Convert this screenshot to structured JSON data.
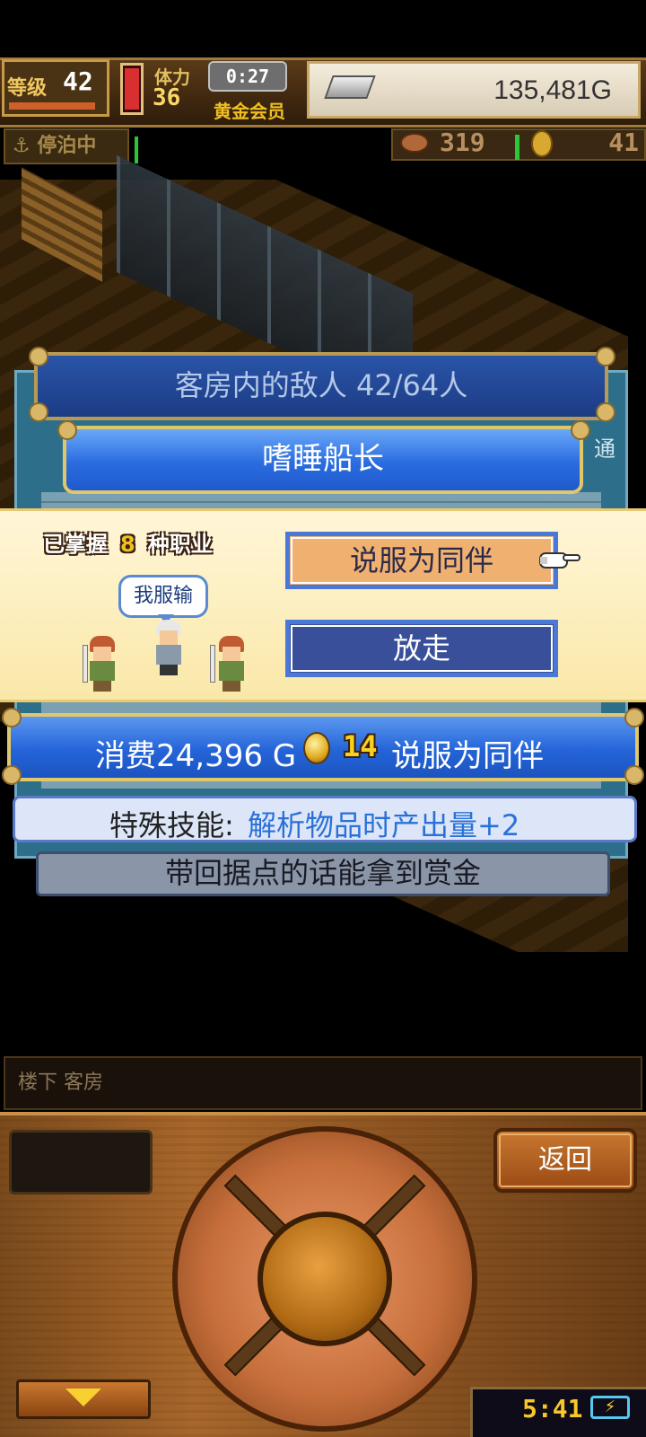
{
  "hud": {
    "level_label": "等级",
    "level": "42",
    "stamina_label": "体力",
    "stamina": "36",
    "timer": "0:27",
    "membership": "黄金会员",
    "gold": "135,481G",
    "dock_status": "停泊中",
    "anchor_icon": "⚓",
    "food": "319",
    "coins": "41"
  },
  "panel": {
    "title": "客房内的敌人  42/64人",
    "enemy_name": "嗜睡船长",
    "side_glyph": "通"
  },
  "dialog": {
    "mastered_prefix": "已掌握",
    "mastered_count": "8",
    "mastered_suffix": "种职业",
    "speech": "我服输",
    "recruit_button": "说服为同伴",
    "release_button": "放走"
  },
  "cost": {
    "text": "消费24,396 G",
    "coin_count": "14",
    "action": "说服为同伴"
  },
  "skill": {
    "label": "特殊技能:",
    "value": "解析物品时产出量+2"
  },
  "bounty_text": "带回据点的话能拿到赏金",
  "location": "楼下 客房",
  "console": {
    "back_button": "返回",
    "clock": "5:41",
    "battery_icon": "⚡"
  },
  "colors": {
    "primary_blue": "#2a6ce0",
    "recruit_orange": "#f0b070",
    "release_navy": "#3a4f9a",
    "skill_blue": "#2a70d8",
    "gold_accent": "#e0c86a",
    "wood": "#a8662a"
  },
  "icons": [
    "anchor-icon",
    "meat-icon",
    "coin-icon",
    "silver-bar-icon",
    "pointing-hand-icon",
    "down-arrow-icon",
    "battery-icon"
  ]
}
